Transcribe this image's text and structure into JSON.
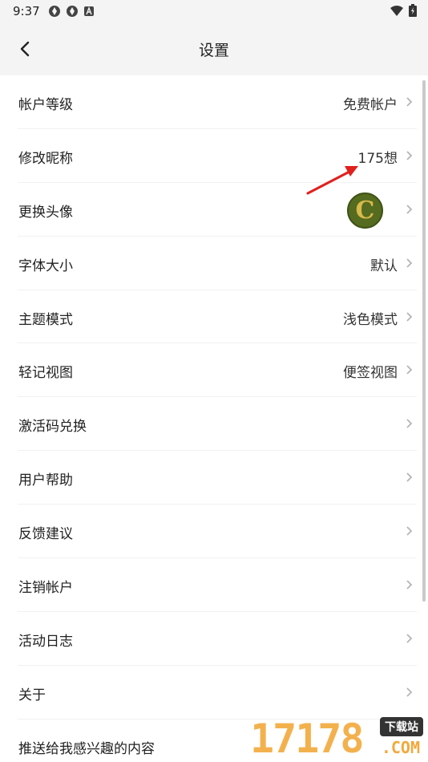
{
  "status_bar": {
    "time": "9:37"
  },
  "header": {
    "title": "设置"
  },
  "rows": [
    {
      "label": "帐户等级",
      "value": "免费帐户"
    },
    {
      "label": "修改昵称",
      "value": "175想"
    },
    {
      "label": "更换头像",
      "avatar_letter": "C"
    },
    {
      "label": "字体大小",
      "value": "默认"
    },
    {
      "label": "主题模式",
      "value": "浅色模式"
    },
    {
      "label": "轻记视图",
      "value": "便签视图"
    },
    {
      "label": "激活码兑换"
    },
    {
      "label": "用户帮助"
    },
    {
      "label": "反馈建议"
    },
    {
      "label": "注销帐户"
    },
    {
      "label": "活动日志"
    },
    {
      "label": "关于"
    },
    {
      "label": "推送给我感兴趣的内容"
    }
  ],
  "watermark": {
    "digits": "17178",
    "tag": "下载站",
    "suffix": ".COM"
  },
  "colors": {
    "background": "#ffffff",
    "header_bg": "#f4f4f4",
    "arrow": "#e0201e",
    "watermark": "#f2a93b"
  }
}
